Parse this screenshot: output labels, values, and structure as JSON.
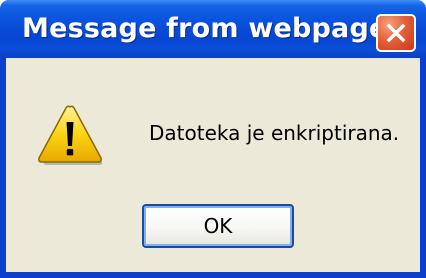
{
  "window": {
    "title": "Message from webpage",
    "close_icon": "close-icon"
  },
  "dialog": {
    "icon": "warning-icon",
    "message": "Datoteka je enkriptirana.",
    "ok_label": "OK"
  },
  "colors": {
    "titlebar": "#0a52dd",
    "close_button": "#e4623a",
    "client_background": "#ece9d8",
    "warning_fill": "#fcd412"
  }
}
